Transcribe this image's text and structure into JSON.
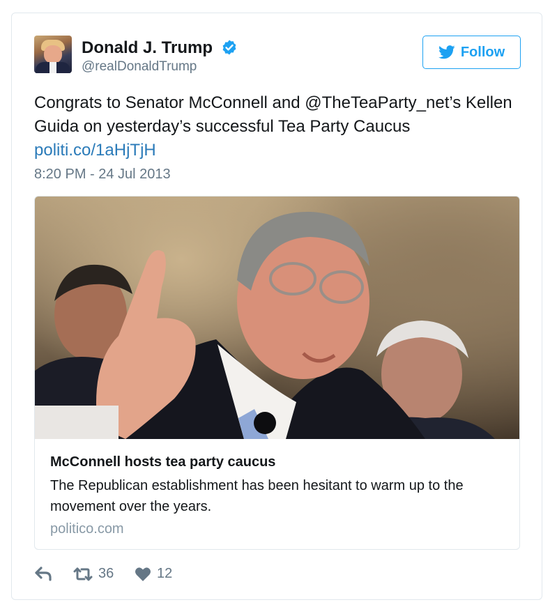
{
  "author": {
    "display_name": "Donald J. Trump",
    "screen_name": "@realDonaldTrump",
    "verified": true
  },
  "follow_button": {
    "label": "Follow",
    "icon": "twitter-bird-icon"
  },
  "tweet": {
    "text": "Congrats to Senator McConnell and @TheTeaParty_net’s Kellen Guida on yesterday’s successful Tea Party Caucus",
    "link": "politi.co/1aHjTjH",
    "timestamp": "8:20 PM - 24 Jul 2013"
  },
  "link_card": {
    "title": "McConnell hosts tea party caucus",
    "description": "The Republican establishment has been hesitant to warm up to the movement over the years.",
    "domain": "politico.com"
  },
  "actions": {
    "reply_icon": "reply-icon",
    "retweet_icon": "retweet-icon",
    "retweet_count": "36",
    "like_icon": "heart-icon",
    "like_count": "12"
  },
  "colors": {
    "accent": "#1da1f2",
    "link": "#2b7bb9",
    "secondary_text": "#657786",
    "border": "#e1e8ed"
  }
}
